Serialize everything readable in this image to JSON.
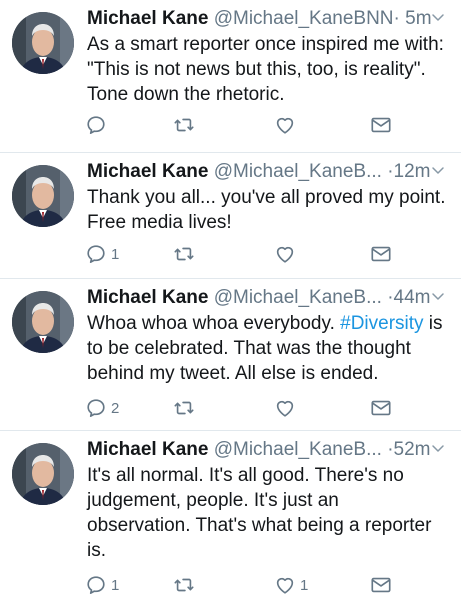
{
  "tweets": [
    {
      "name": "Michael Kane",
      "handle": "@Michael_KaneBNN",
      "separator": "·",
      "time": "5m",
      "text": "As a smart reporter once inspired me with: \"This is not news but this, too, is reality\". Tone down the rhetoric.",
      "reply_count": "",
      "retweet_count": "",
      "like_count": ""
    },
    {
      "name": "Michael Kane",
      "handle": "@Michael_KaneB...",
      "separator": "·",
      "time": "12m",
      "text": "Thank you all... you've all proved my point. Free media lives!",
      "reply_count": "1",
      "retweet_count": "",
      "like_count": ""
    },
    {
      "name": "Michael Kane",
      "handle": "@Michael_KaneB...",
      "separator": "·",
      "time": "44m",
      "text_before": "Whoa whoa whoa everybody. ",
      "hashtag": "#Diversity",
      "text_after": " is to be celebrated. That was the thought behind my tweet. All else is ended.",
      "reply_count": "2",
      "retweet_count": "",
      "like_count": ""
    },
    {
      "name": "Michael Kane",
      "handle": "@Michael_KaneB...",
      "separator": "·",
      "time": "52m",
      "text": "It's all normal. It's all good. There's no judgement, people. It's just an observation. That's what being a reporter is.",
      "reply_count": "1",
      "retweet_count": "",
      "like_count": "1"
    }
  ],
  "colors": {
    "text": "#14171a",
    "muted": "#657786",
    "link": "#1b95e0",
    "divider": "#e1e8ed"
  },
  "icons": [
    "reply-icon",
    "retweet-icon",
    "like-icon",
    "dm-icon",
    "chevron-down-icon"
  ]
}
